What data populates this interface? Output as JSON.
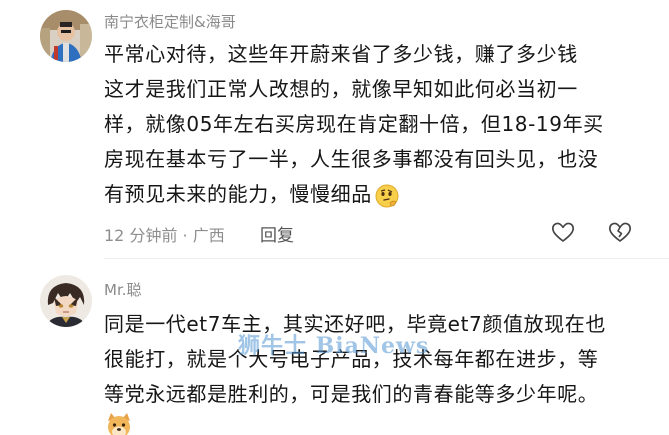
{
  "comments": [
    {
      "username": "南宁衣柜定制&海哥",
      "avatar": "user-avatar",
      "lines": [
        "平常心对待，这些年开蔚来省了多少钱，赚了多少钱",
        "这才是我们正常人改想的，就像早知如此何必当初一",
        "样，就像05年左右买房现在肯定翻十倍，但18-19年买",
        "房现在基本亏了一半，人生很多事都没有回头见，也没",
        "有预见未来的能力，慢慢细品"
      ],
      "emoji": "thinking-emoji",
      "meta": "12 分钟前 · 广西",
      "reply_label": "回复",
      "like_icon": "heart-outline-icon",
      "dislike_icon": "broken-heart-icon"
    },
    {
      "username": "Mr.聪",
      "avatar": "anime-avatar",
      "lines": [
        "同是一代et7车主，其实还好吧，毕竟et7颜值放现在也",
        "很能打，就是个大号电子产品，技术每年都在进步，等",
        "等党永远都是胜利的，可是我们的青春能等多少年呢。"
      ],
      "emoji": "dog-emoji"
    }
  ],
  "watermark": "狮牛士 BiaNews",
  "colors": {
    "text": "#161616",
    "username": "#8a8a8a",
    "meta": "#8e8e8e",
    "watermark": "#5296d2"
  }
}
